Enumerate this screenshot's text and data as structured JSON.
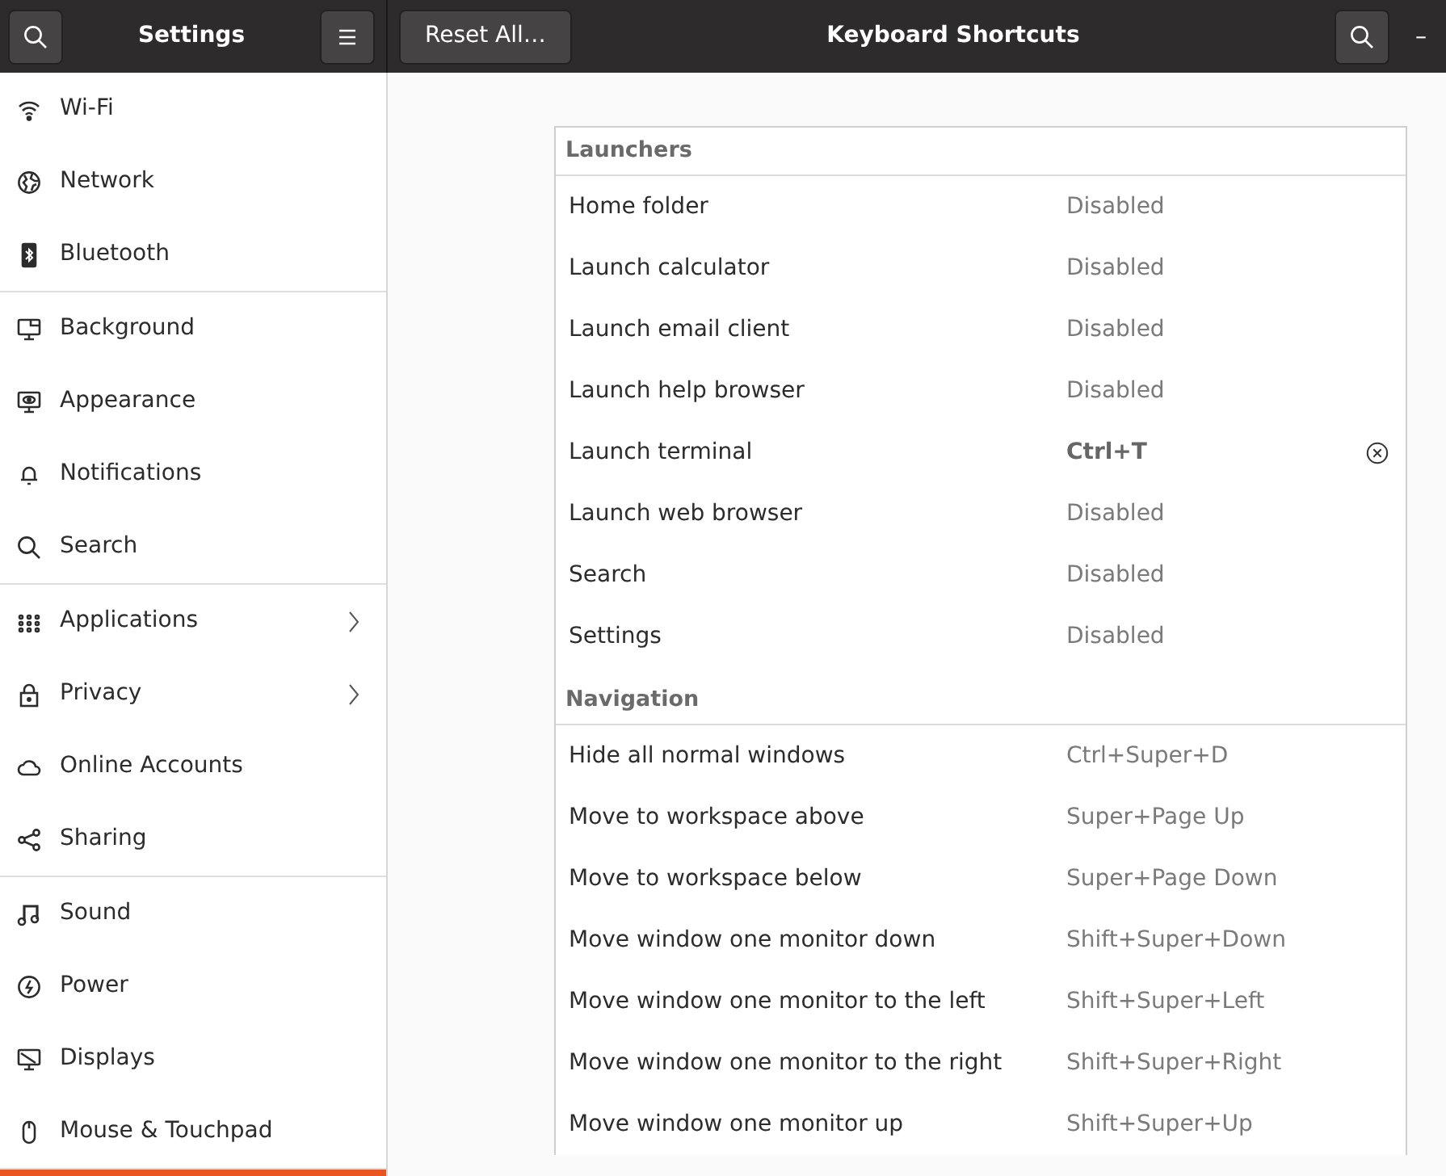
{
  "header": {
    "title": "Settings",
    "reset_button": "Reset All…",
    "panel_title": "Keyboard Shortcuts",
    "minimize": "–"
  },
  "sidebar": {
    "groups": [
      [
        {
          "label": "Wi-Fi",
          "has_arrow": false
        },
        {
          "label": "Network",
          "has_arrow": false
        },
        {
          "label": "Bluetooth",
          "has_arrow": false
        }
      ],
      [
        {
          "label": "Background",
          "has_arrow": false
        },
        {
          "label": "Appearance",
          "has_arrow": false
        },
        {
          "label": "Notifications",
          "has_arrow": false
        },
        {
          "label": "Search",
          "has_arrow": false
        }
      ],
      [
        {
          "label": "Applications",
          "has_arrow": true
        },
        {
          "label": "Privacy",
          "has_arrow": true
        },
        {
          "label": "Online Accounts",
          "has_arrow": false
        },
        {
          "label": "Sharing",
          "has_arrow": false
        }
      ],
      [
        {
          "label": "Sound",
          "has_arrow": false
        },
        {
          "label": "Power",
          "has_arrow": false
        },
        {
          "label": "Displays",
          "has_arrow": false
        },
        {
          "label": "Mouse & Touchpad",
          "has_arrow": false
        }
      ]
    ]
  },
  "sections": [
    {
      "title": "Launchers",
      "rows": [
        {
          "name": "Home folder",
          "shortcut": "Disabled",
          "custom": false
        },
        {
          "name": "Launch calculator",
          "shortcut": "Disabled",
          "custom": false
        },
        {
          "name": "Launch email client",
          "shortcut": "Disabled",
          "custom": false
        },
        {
          "name": "Launch help browser",
          "shortcut": "Disabled",
          "custom": false
        },
        {
          "name": "Launch terminal",
          "shortcut": "Ctrl+T",
          "custom": true
        },
        {
          "name": "Launch web browser",
          "shortcut": "Disabled",
          "custom": false
        },
        {
          "name": "Search",
          "shortcut": "Disabled",
          "custom": false
        },
        {
          "name": "Settings",
          "shortcut": "Disabled",
          "custom": false
        }
      ]
    },
    {
      "title": "Navigation",
      "rows": [
        {
          "name": "Hide all normal windows",
          "shortcut": "Ctrl+Super+D",
          "custom": false
        },
        {
          "name": "Move to workspace above",
          "shortcut": "Super+Page Up",
          "custom": false
        },
        {
          "name": "Move to workspace below",
          "shortcut": "Super+Page Down",
          "custom": false
        },
        {
          "name": "Move window one monitor down",
          "shortcut": "Shift+Super+Down",
          "custom": false
        },
        {
          "name": "Move window one monitor to the left",
          "shortcut": "Shift+Super+Left",
          "custom": false
        },
        {
          "name": "Move window one monitor to the right",
          "shortcut": "Shift+Super+Right",
          "custom": false
        },
        {
          "name": "Move window one monitor up",
          "shortcut": "Shift+Super+Up",
          "custom": false
        }
      ]
    }
  ]
}
